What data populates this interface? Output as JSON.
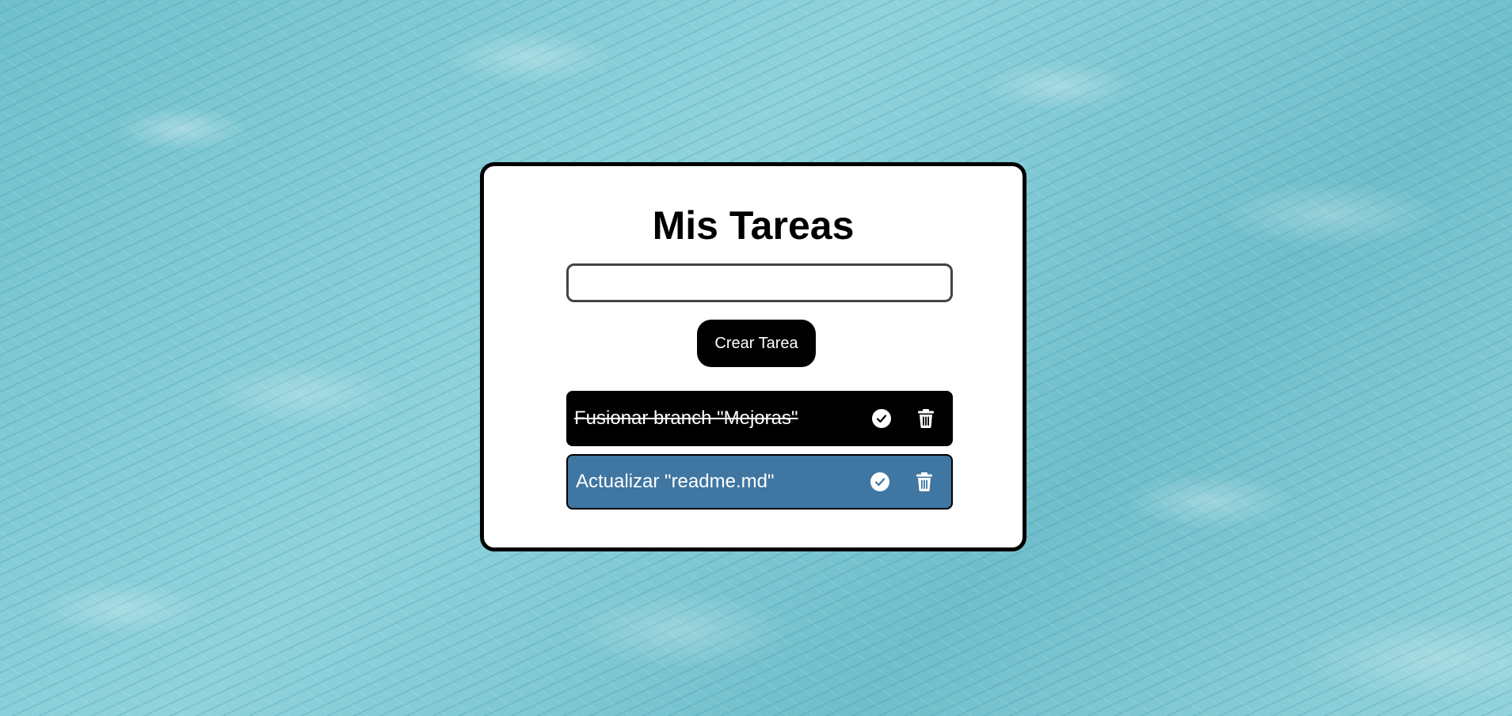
{
  "app": {
    "title": "Mis Tareas"
  },
  "form": {
    "input_value": "",
    "input_placeholder": "",
    "create_button_label": "Crear Tarea"
  },
  "tasks": [
    {
      "text": "Fusionar branch \"Mejoras\"",
      "completed": true,
      "background": "#000000",
      "check_icon": "check-circle-icon",
      "delete_icon": "trash-icon"
    },
    {
      "text": "Actualizar \"readme.md\"",
      "completed": false,
      "background": "#3f76a2",
      "check_icon": "check-circle-icon",
      "delete_icon": "trash-icon"
    }
  ],
  "colors": {
    "background": "#7fc8d3",
    "card": "#ffffff",
    "accent": "#000000",
    "task_active": "#3f76a2"
  }
}
